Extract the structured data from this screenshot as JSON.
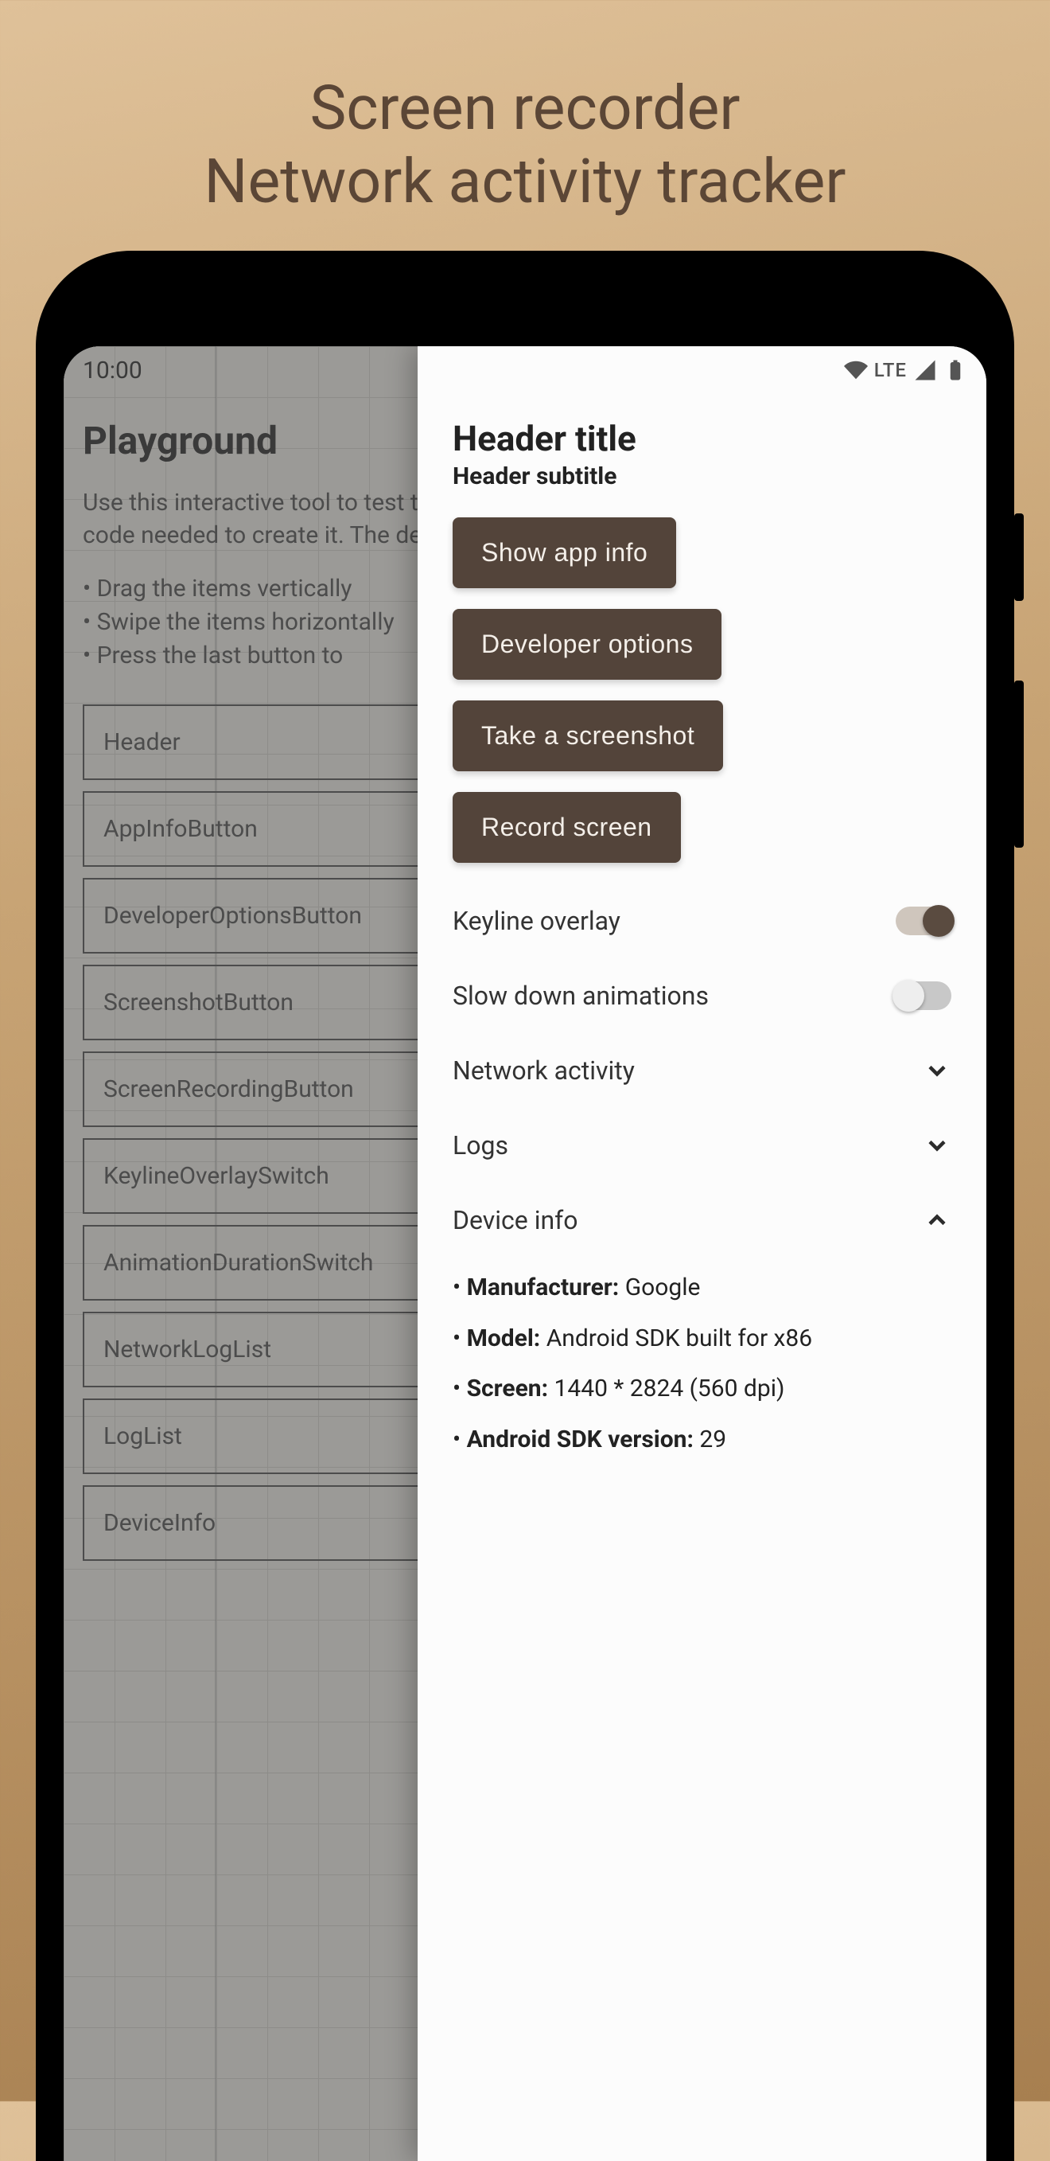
{
  "promo": {
    "line1": "Screen recorder",
    "line2": "Network activity tracker"
  },
  "status": {
    "time": "10:00",
    "net_label": "LTE"
  },
  "background": {
    "title": "Playground",
    "paragraph": "Use this interactive tool to test the library with any configuration and generate the code needed to create it. The debug menu on the right is updated in real time.",
    "tips": [
      "Drag the items vertically",
      "Swipe the items horizontally",
      "Press the last button to"
    ],
    "items": [
      "Header",
      "AppInfoButton",
      "DeveloperOptionsButton",
      "ScreenshotButton",
      "ScreenRecordingButton",
      "KeylineOverlaySwitch",
      "AnimationDurationSwitch",
      "NetworkLogList",
      "LogList",
      "DeviceInfo"
    ]
  },
  "drawer": {
    "header_title": "Header title",
    "header_subtitle": "Header subtitle",
    "buttons": {
      "app_info": "Show app info",
      "dev_options": "Developer options",
      "screenshot": "Take a screenshot",
      "record": "Record screen"
    },
    "switches": {
      "keyline": {
        "label": "Keyline overlay",
        "on": true
      },
      "slow_anim": {
        "label": "Slow down animations",
        "on": false
      }
    },
    "expanders": {
      "network": {
        "label": "Network activity",
        "expanded": false
      },
      "logs": {
        "label": "Logs",
        "expanded": false
      },
      "device": {
        "label": "Device info",
        "expanded": true
      }
    },
    "device_info": {
      "manufacturer_label": "Manufacturer:",
      "manufacturer_value": "Google",
      "model_label": "Model:",
      "model_value": "Android SDK built for x86",
      "screen_label": "Screen:",
      "screen_value": "1440 * 2824 (560 dpi)",
      "sdk_label": "Android SDK version:",
      "sdk_value": "29"
    }
  }
}
